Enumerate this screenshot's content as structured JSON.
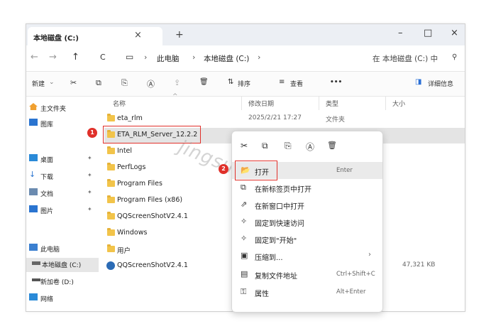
{
  "window": {
    "tab_title": "本地磁盘 (C:)",
    "tab_close": "×",
    "new_tab": "+",
    "minimize": "–",
    "maximize": "□",
    "close": "×"
  },
  "address": {
    "back": "←",
    "forward": "→",
    "up": "↑",
    "refresh": "C",
    "pc_icon": "▭",
    "sep": "›",
    "crumbs": [
      "此电脑",
      "本地磁盘 (C:)"
    ],
    "search_placeholder": "在 本地磁盘 (C:) 中",
    "search_icon": "⚲"
  },
  "toolbar": {
    "new": "新建",
    "new_caret": "⌄",
    "cut_icon": "✂",
    "copy_icon": "⧉",
    "paste_icon": "⎘",
    "rename_icon": "Ⓐ",
    "share_icon": "⇪",
    "delete_icon": "🗑",
    "sort": "排序",
    "view": "查看",
    "more": "•••",
    "details": "详细信息"
  },
  "sidebar": {
    "items": [
      {
        "label": "主文件夹",
        "pin": ""
      },
      {
        "label": "图库",
        "pin": ""
      },
      {
        "label": "桌面",
        "pin": "✦"
      },
      {
        "label": "下载",
        "pin": "✦"
      },
      {
        "label": "文档",
        "pin": "✦"
      },
      {
        "label": "图片",
        "pin": "✦"
      },
      {
        "label": "此电脑",
        "pin": ""
      },
      {
        "label": "本地磁盘 (C:)",
        "pin": ""
      },
      {
        "label": "新加卷 (D:)",
        "pin": ""
      },
      {
        "label": "网络",
        "pin": ""
      }
    ]
  },
  "columns": {
    "name": "名称",
    "date": "修改日期",
    "type": "类型",
    "size": "大小"
  },
  "files": [
    {
      "name": "eta_rlm",
      "date": "2025/2/21 17:27",
      "type": "文件夹",
      "size": ""
    },
    {
      "name": "ETA_RLM_Server_12.2.2",
      "date": "",
      "type": "",
      "size": ""
    },
    {
      "name": "Intel",
      "date": "",
      "type": "",
      "size": ""
    },
    {
      "name": "PerfLogs",
      "date": "",
      "type": "",
      "size": ""
    },
    {
      "name": "Program Files",
      "date": "",
      "type": "",
      "size": ""
    },
    {
      "name": "Program Files (x86)",
      "date": "",
      "type": "",
      "size": ""
    },
    {
      "name": "QQScreenShotV2.4.1",
      "date": "",
      "type": "",
      "size": ""
    },
    {
      "name": "Windows",
      "date": "",
      "type": "",
      "size": ""
    },
    {
      "name": "用户",
      "date": "",
      "type": "",
      "size": ""
    },
    {
      "name": "QQScreenShotV2.4.1",
      "date": "",
      "type": "",
      "size": "47,321 KB"
    }
  ],
  "context_menu": {
    "quick_icons": [
      "✂",
      "⧉",
      "⎘",
      "Ⓐ",
      "🗑"
    ],
    "items": [
      {
        "icon": "📂",
        "label": "打开",
        "shortcut": "Enter"
      },
      {
        "icon": "⧉",
        "label": "在新标签页中打开",
        "shortcut": ""
      },
      {
        "icon": "⇗",
        "label": "在新窗口中打开",
        "shortcut": ""
      },
      {
        "icon": "✧",
        "label": "固定到快速访问",
        "shortcut": ""
      },
      {
        "icon": "✧",
        "label": "固定到\"开始\"",
        "shortcut": ""
      },
      {
        "icon": "▣",
        "label": "压缩到...",
        "shortcut": "›"
      },
      {
        "icon": "▤",
        "label": "复制文件地址",
        "shortcut": "Ctrl+Shift+C"
      },
      {
        "icon": "⚿",
        "label": "属性",
        "shortcut": "Alt+Enter"
      }
    ]
  },
  "annotations": {
    "badge1": "1",
    "badge2": "2"
  },
  "watermark": "jingsuwang2"
}
